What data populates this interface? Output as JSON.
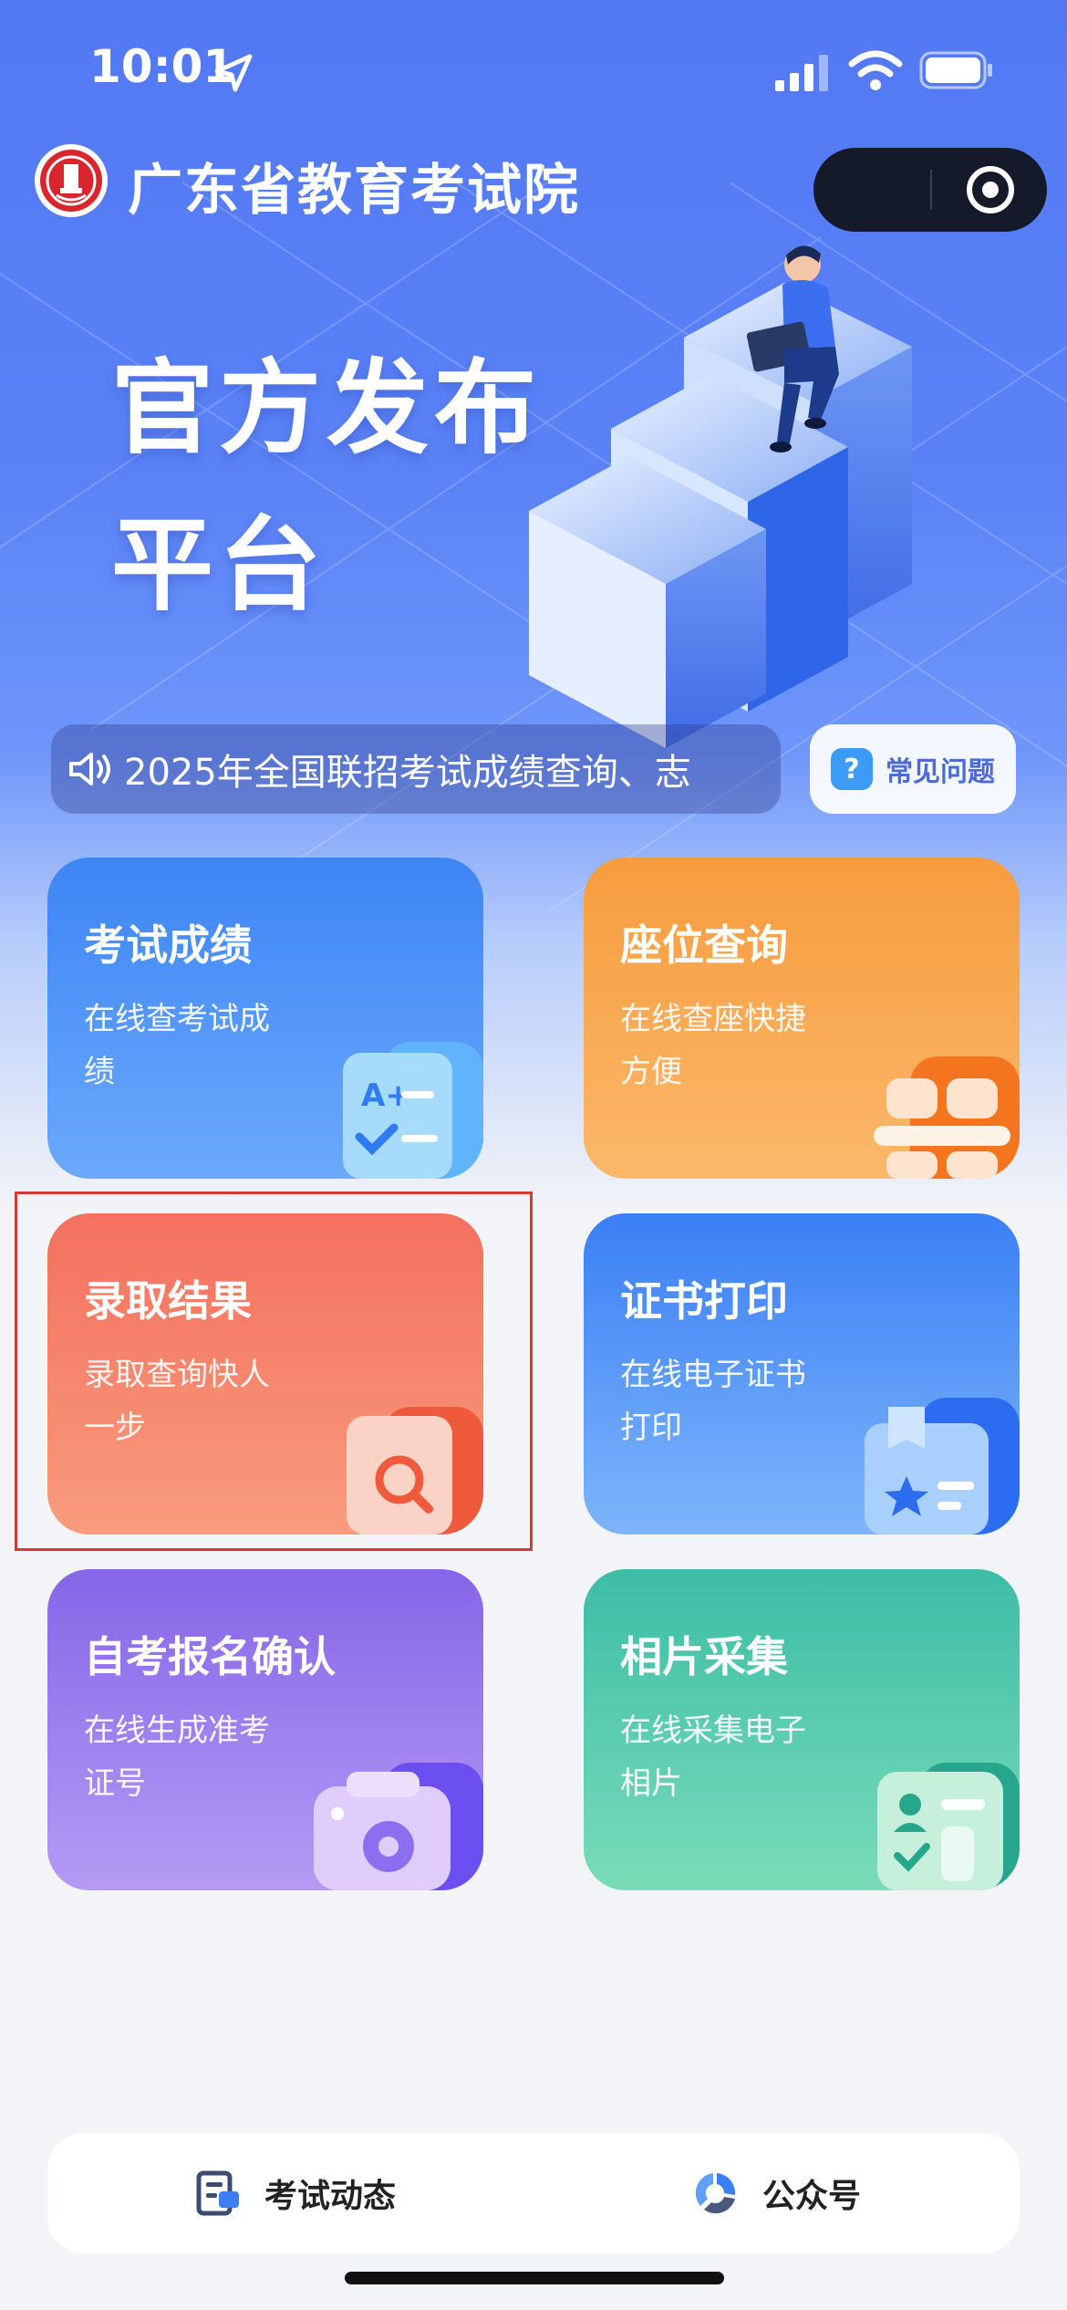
{
  "status_bar": {
    "time": "10:01"
  },
  "header": {
    "title": "广东省教育考试院"
  },
  "hero": {
    "slogan_line1": "官方发布",
    "slogan_line2": "平台"
  },
  "notice": {
    "text": "2025年全国联招考试成绩查询、志"
  },
  "faq": {
    "label": "常见问题",
    "icon": "question-icon"
  },
  "cards": [
    {
      "title": "考试成绩",
      "desc": "在线查考试成绩",
      "icon": "score-sheet-icon",
      "color": "#3e85f6"
    },
    {
      "title": "座位查询",
      "desc": "在线查座快捷方便",
      "icon": "seat-icon",
      "color": "#f79c3e"
    },
    {
      "title": "录取结果",
      "desc": "录取查询快人一步",
      "icon": "search-document-icon",
      "color": "#f4705e"
    },
    {
      "title": "证书打印",
      "desc": "在线电子证书打印",
      "icon": "certificate-icon",
      "color": "#3a7ff5"
    },
    {
      "title": "自考报名确认",
      "desc": "在线生成准考证号",
      "icon": "camera-icon",
      "color": "#8666e8"
    },
    {
      "title": "相片采集",
      "desc": "在线采集电子相片",
      "icon": "id-photo-icon",
      "color": "#3dbda6"
    }
  ],
  "tabbar": [
    {
      "label": "考试动态",
      "icon": "news-icon"
    },
    {
      "label": "公众号",
      "icon": "official-account-icon"
    }
  ],
  "colors": {
    "highlight": "#d43a35",
    "hero": "#5278f4"
  }
}
